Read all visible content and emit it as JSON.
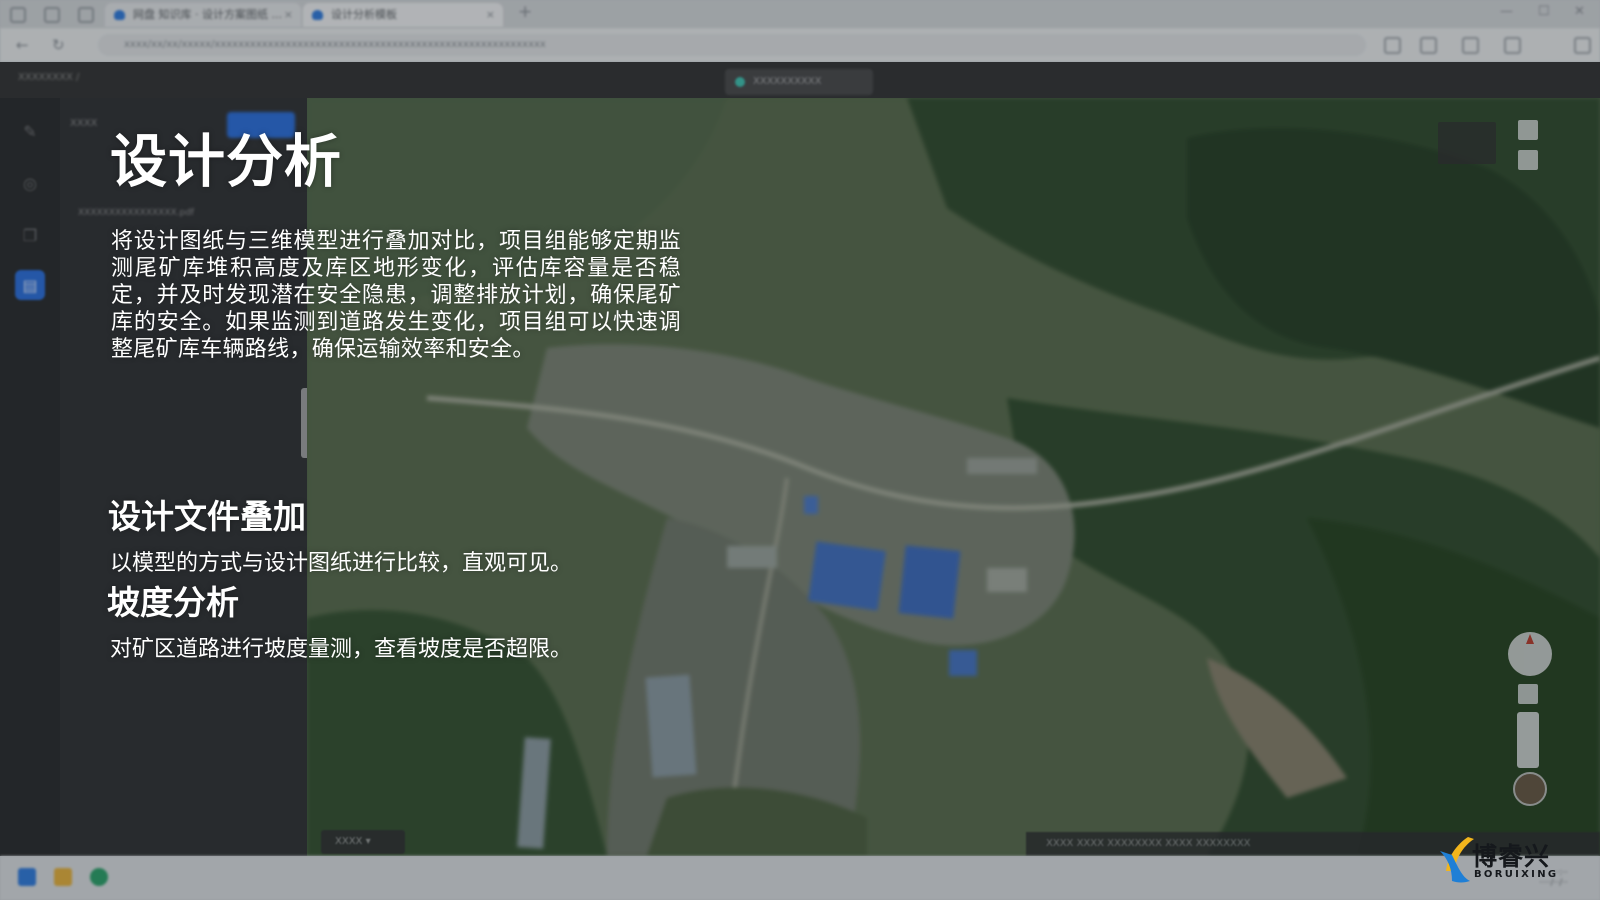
{
  "browser": {
    "tabs": [
      {
        "label": "网盘 知识库 · 设计方案图纸 ..."
      },
      {
        "label": "设计分析模板"
      }
    ],
    "url": "xxxx/xx/xx/xxxxx/xxxxxxxxxxxxxxxxxxxxxxxxxxxxxxxxxxxxxxxxxxxxxxxxxxxxxxxx"
  },
  "app": {
    "project_title": "XXXXXXXX /",
    "center_pill": "XXXXXXXXXX",
    "panel_title": "XXXX",
    "panel_file": "XXXXXXXXXXXXXXXX.pdf",
    "basemap_button": "XXXX ▾",
    "status_bar": "XXXX  XXXX  XXXXXXXX  XXXX  XXXXXXXX"
  },
  "slide": {
    "title": "设计分析",
    "intro": "将设计图纸与三维模型进行叠加对比，项目组能够定期监测尾矿库堆积高度及库区地形变化，评估库容量是否稳定，并及时发现潜在安全隐患，调整排放计划，确保尾矿库的安全。如果监测到道路发生变化，项目组可以快速调整尾矿库车辆路线，确保运输效率和安全。",
    "sections": [
      {
        "title": "设计文件叠加",
        "desc": "以模型的方式与设计图纸进行比较，直观可见。"
      },
      {
        "title": "坡度分析",
        "desc": "对矿区道路进行坡度量测，查看坡度是否超限。"
      }
    ]
  },
  "logo": {
    "cn": "博睿兴",
    "en": "BORUIXING",
    "colors": {
      "blue": "#1f7fd6",
      "yellow": "#f2b51c",
      "text": "#15181c"
    }
  },
  "colors": {
    "rail_active": "#2a6fe0",
    "app_dark": "#2f3033",
    "overlay": "rgba(28,32,36,0.30)"
  },
  "icons": {
    "rail": [
      "pencil-icon",
      "target-icon",
      "layers-icon",
      "document-icon"
    ]
  }
}
